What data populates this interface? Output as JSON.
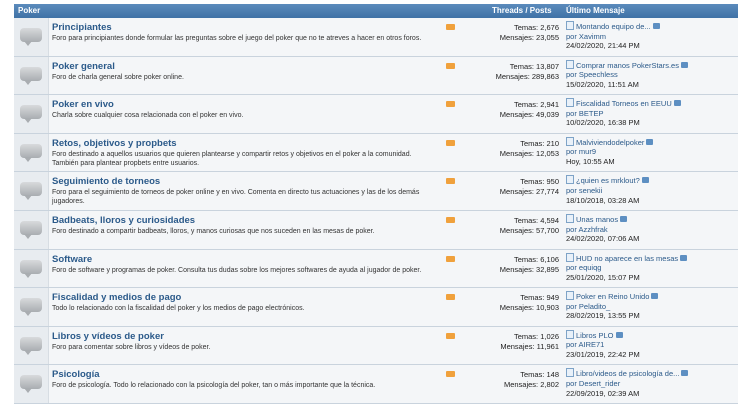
{
  "header": {
    "forum": "Poker",
    "threads_posts": "Threads / Posts",
    "last_message": "Último Mensaje"
  },
  "forums": [
    {
      "title": "Principiantes",
      "desc": "Foro para principiantes donde formular las preguntas sobre el juego del poker que no te atreves a hacer en otros foros.",
      "temas": "Temas: 2,676",
      "mensajes": "Mensajes: 23,055",
      "last_title": "Montando equipo de...",
      "last_user": "por Xavimm",
      "last_date": "24/02/2020, 21:44 PM"
    },
    {
      "title": "Poker general",
      "desc": "Foro de charla general sobre poker online.",
      "temas": "Temas: 13,807",
      "mensajes": "Mensajes: 289,863",
      "last_title": "Comprar manos PokerStars.es",
      "last_user": "por Speechless",
      "last_date": "15/02/2020, 11:51 AM"
    },
    {
      "title": "Poker en vivo",
      "desc": "Charla sobre cualquier cosa relacionada con el poker en vivo.",
      "temas": "Temas: 2,941",
      "mensajes": "Mensajes: 49,039",
      "last_title": "Fiscalidad Torneos en EEUU",
      "last_user": "por BETEP",
      "last_date": "10/02/2020, 16:38 PM"
    },
    {
      "title": "Retos, objetivos y propbets",
      "desc": "Foro destinado a aquellos usuarios que quieren plantearse y compartir retos y objetivos en el poker a la comunidad. También para plantear propbets entre usuarios.",
      "temas": "Temas: 210",
      "mensajes": "Mensajes: 12,053",
      "last_title": "Malviviendodelpoker",
      "last_user": "por mur9",
      "last_date": "Hoy, 10:55 AM"
    },
    {
      "title": "Seguimiento de torneos",
      "desc": "Foro para el seguimiento de torneos de poker online y en vivo. Comenta en directo tus actuaciones y las de los demás jugadores.",
      "temas": "Temas: 950",
      "mensajes": "Mensajes: 27,774",
      "last_title": "¿quien es mrklout?",
      "last_user": "por senekii",
      "last_date": "18/10/2018, 03:28 AM"
    },
    {
      "title": "Badbeats, lloros y curiosidades",
      "desc": "Foro destinado a compartir badbeats, lloros, y manos curiosas que nos suceden en las mesas de poker.",
      "temas": "Temas: 4,594",
      "mensajes": "Mensajes: 57,700",
      "last_title": "Unas manos",
      "last_user": "por Azzhfrak",
      "last_date": "24/02/2020, 07:06 AM"
    },
    {
      "title": "Software",
      "desc": "Foro de software y programas de poker. Consulta tus dudas sobre los mejores softwares de ayuda al jugador de poker.",
      "temas": "Temas: 6,106",
      "mensajes": "Mensajes: 32,895",
      "last_title": "HUD no aparece en las mesas",
      "last_user": "por equiqg",
      "last_date": "25/01/2020, 15:07 PM"
    },
    {
      "title": "Fiscalidad y medios de pago",
      "desc": "Todo lo relacionado con la fiscalidad del poker y los medios de pago electrónicos.",
      "temas": "Temas: 949",
      "mensajes": "Mensajes: 10,903",
      "last_title": "Poker en Reino Unido",
      "last_user": "por Peladito_",
      "last_date": "28/02/2019, 13:55 PM"
    },
    {
      "title": "Libros y vídeos de poker",
      "desc": "Foro para comentar sobre libros y vídeos de poker.",
      "temas": "Temas: 1,026",
      "mensajes": "Mensajes: 11,961",
      "last_title": "Libros PLO",
      "last_user": "por AIRE71",
      "last_date": "23/01/2019, 22:42 PM"
    },
    {
      "title": "Psicología",
      "desc": "Foro de psicología. Todo lo relacionado con la psicología del poker, tan o más importante que la técnica.",
      "temas": "Temas: 148",
      "mensajes": "Mensajes: 2,802",
      "last_title": "Libro/videos de psicología de...",
      "last_user": "por Desert_rider",
      "last_date": "22/09/2019, 02:39 AM"
    }
  ]
}
